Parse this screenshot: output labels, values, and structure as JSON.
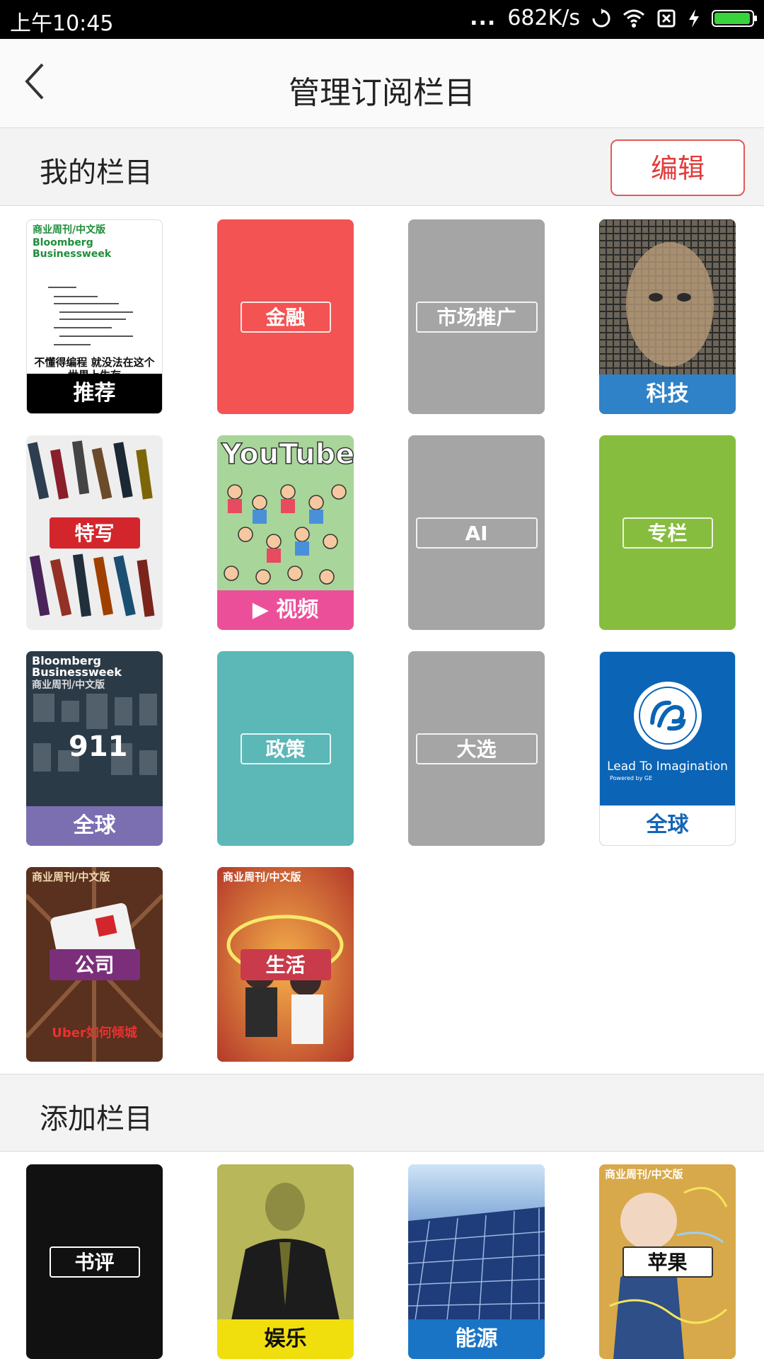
{
  "status_bar": {
    "time": "上午10:45",
    "dots": "...",
    "speed": "682K/s"
  },
  "header": {
    "title": "管理订阅栏目"
  },
  "my_section": {
    "label": "我的栏目",
    "edit_label": "编辑"
  },
  "my_tiles": [
    {
      "label": "推荐",
      "cover_title": "商业周刊/中文版",
      "cover_brand": "Bloomberg Businessweek",
      "cover_headline": "不懂得编程 就没法在这个世界上生存"
    },
    {
      "label": "金融"
    },
    {
      "label": "市场推广"
    },
    {
      "label": "科技"
    },
    {
      "label": "特写"
    },
    {
      "label": "视频",
      "cover_title": "YouTube"
    },
    {
      "label": "AI"
    },
    {
      "label": "专栏"
    },
    {
      "label": "全球",
      "cover_brand": "Bloomberg Businessweek",
      "cover_title": "商业周刊/中文版",
      "cover_number": "911"
    },
    {
      "label": "政策"
    },
    {
      "label": "大选"
    },
    {
      "label": "全球",
      "cover_slogan": "Lead To Imagination",
      "cover_sub": "Powered by GE"
    },
    {
      "label": "公司",
      "cover_title": "商业周刊/中文版",
      "cover_headline": "Uber如何倾城"
    },
    {
      "label": "生活",
      "cover_title": "商业周刊/中文版"
    }
  ],
  "add_section": {
    "label": "添加栏目"
  },
  "add_tiles": [
    {
      "label": "书评"
    },
    {
      "label": "娱乐"
    },
    {
      "label": "能源"
    },
    {
      "label": "苹果",
      "cover_title": "商业周刊/中文版"
    }
  ],
  "colors": {
    "accent_red": "#e13b3b",
    "finance": "#f45353",
    "gray": "#a5a5a5",
    "teal": "#5bb8b7",
    "green": "#86bd3e",
    "tech_blue": "#2f82c8",
    "global_purple": "#7c6fb1",
    "video_pink": "#ec4f9a",
    "ge_blue": "#0b64b5",
    "yellow": "#f1df0d",
    "energy_blue": "#1a74c5"
  }
}
